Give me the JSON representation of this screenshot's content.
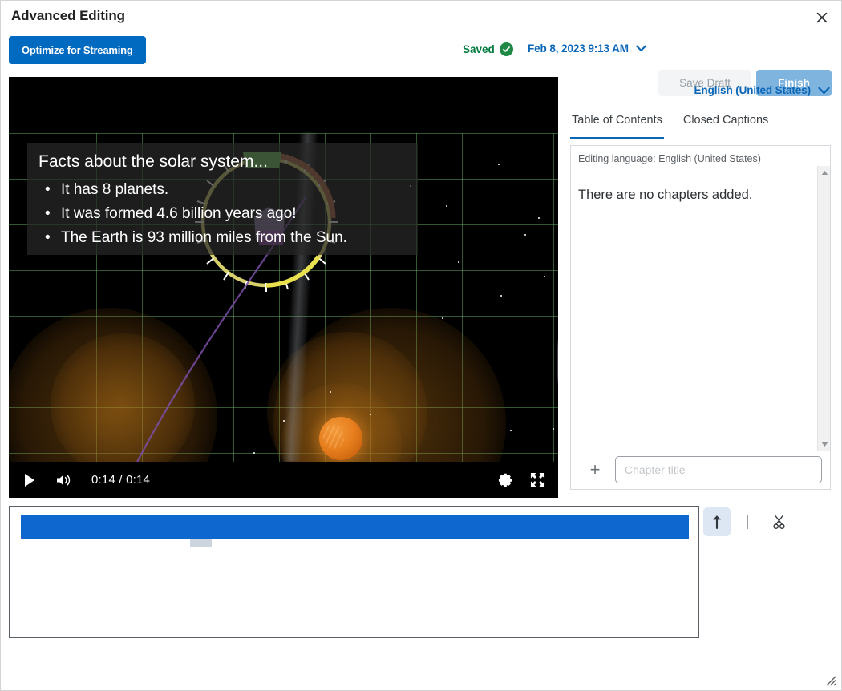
{
  "window": {
    "title": "Advanced Editing",
    "close_label": "Close",
    "close_icon": "close-icon",
    "resize_icon": "resize-grip-icon"
  },
  "toolbar": {
    "optimize_label": "Optimize for Streaming",
    "saved_label": "Saved",
    "saved_icon": "check-circle-icon",
    "timestamp": "Feb 8, 2023 9:13 AM",
    "timestamp_chevron_icon": "chevron-down-icon",
    "save_draft_label": "Save Draft",
    "finish_label": "Finish"
  },
  "player": {
    "current_time": "0:14",
    "duration": "0:14",
    "time_display": "0:14 / 0:14",
    "play_icon": "play-icon",
    "volume_icon": "volume-icon",
    "settings_icon": "gear-icon",
    "fullscreen_icon": "fullscreen-icon",
    "caption": {
      "title": "Facts about the solar system...",
      "bullets": [
        "It has 8 planets.",
        "It was formed 4.6 billion years ago!",
        "The Earth is 93 million miles from the Sun."
      ]
    }
  },
  "right_panel": {
    "language_label": "English (United States)",
    "language_chevron_icon": "chevron-down-icon",
    "tabs": [
      {
        "label": "Table of Contents",
        "active": true
      },
      {
        "label": "Closed Captions",
        "active": false
      }
    ],
    "editing_language": "Editing language: English (United States)",
    "empty_state": "There are no chapters added.",
    "add_chapter": {
      "plus_label": "+",
      "input_value": "",
      "input_placeholder": "Chapter title"
    },
    "scrollbar": {
      "up_icon": "scroll-up-arrow-icon",
      "down_icon": "scroll-down-arrow-icon"
    }
  },
  "timeline": {
    "track_color": "#0d67ce",
    "marker_color": "#ccd4dd",
    "tools": [
      {
        "name": "split-tool",
        "icon": "up-arrow-icon",
        "active": true
      },
      {
        "name": "cut-tool",
        "icon": "scissors-icon",
        "active": false
      }
    ]
  },
  "colors": {
    "brand_blue": "#0069c0",
    "link_blue": "#0a66b7",
    "saved_green": "#007a3e",
    "finish_blue": "#7eb4dd",
    "track_blue": "#0d67ce"
  }
}
